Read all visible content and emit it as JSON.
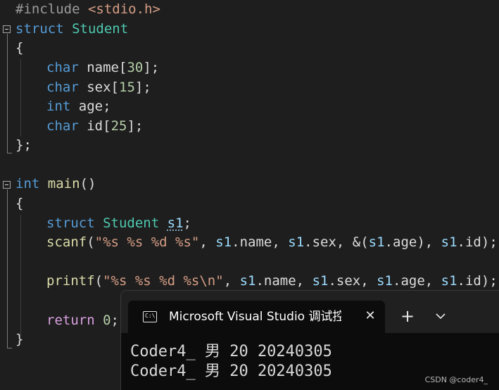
{
  "editor": {
    "lines": {
      "include": {
        "directive": "#include ",
        "header": "<stdio.h>"
      },
      "struct_decl": {
        "kw": "struct",
        "name": "Student"
      },
      "open_brace_1": "{",
      "field_name": {
        "type": "char",
        "name": "name",
        "open": "[",
        "size": "30",
        "close": "];"
      },
      "field_sex": {
        "type": "char",
        "name": "sex",
        "open": "[",
        "size": "15",
        "close": "];"
      },
      "field_age": {
        "type": "int",
        "name": "age",
        "close": ";"
      },
      "field_id": {
        "type": "char",
        "name": "id",
        "open": "[",
        "size": "25",
        "close": "];"
      },
      "close_brace_1": "};",
      "main_decl": {
        "kw": "int",
        "name": "main",
        "parens": "()"
      },
      "open_brace_2": "{",
      "var_decl": {
        "kw": "struct",
        "type": "Student",
        "var": "s1",
        "end": ";"
      },
      "scanf_line": {
        "fn": "scanf",
        "open": "(",
        "fmt": "\"%s %s %d %s\"",
        "p1": ", ",
        "a1": "s1",
        "m1": ".name",
        "p2": ", ",
        "a2": "s1",
        "m2": ".sex",
        "p3": ", &(",
        "a3": "s1",
        "m3": ".age",
        "p4": "), ",
        "a4": "s1",
        "m4": ".id",
        "close": ");"
      },
      "printf_line": {
        "fn": "printf",
        "open": "(",
        "fmt": "\"%s %s %d %s\\n\"",
        "p1": ", ",
        "a1": "s1",
        "m1": ".name",
        "p2": ", ",
        "a2": "s1",
        "m2": ".sex",
        "p3": ", ",
        "a3": "s1",
        "m3": ".age",
        "p4": ", ",
        "a4": "s1",
        "m4": ".id",
        "close": ");"
      },
      "return_line": {
        "kw": "return",
        "value": "0",
        "end": ";"
      },
      "close_brace_2": "}"
    }
  },
  "terminal": {
    "tab_icon_glyph": "C:\\",
    "tab_title": "Microsoft Visual Studio 调试控制台",
    "close_glyph": "✕",
    "new_tab_glyph": "+",
    "output": [
      "Coder4_ 男 20 20240305",
      "Coder4_ 男 20 20240305"
    ]
  },
  "watermark": "CSDN @coder4_",
  "colors": {
    "background": "#1e1e1e",
    "keyword": "#569cd6",
    "type": "#4ec9b0",
    "function": "#dcdcaa",
    "string": "#d69d85",
    "number": "#b5cea8",
    "variable": "#9cdcfe",
    "control": "#d8a0df",
    "terminal_bg": "#0c0c0c"
  }
}
